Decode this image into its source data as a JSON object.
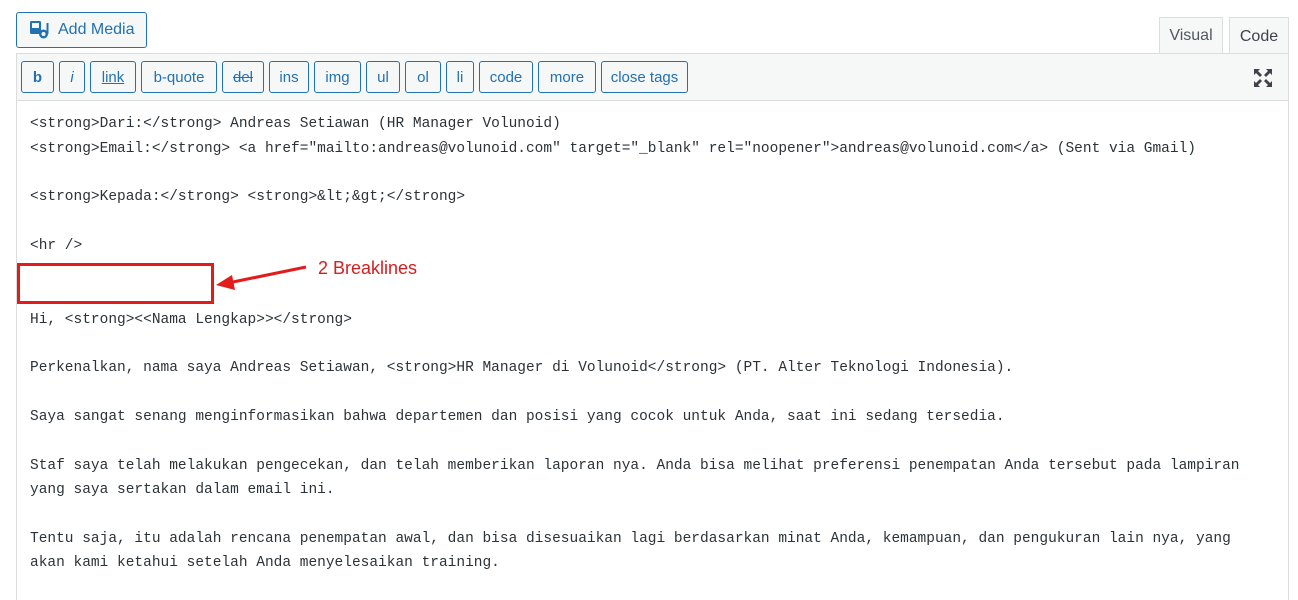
{
  "header": {
    "add_media_label": "Add Media",
    "tabs": [
      {
        "label": "Visual",
        "active": false
      },
      {
        "label": "Code",
        "active": true
      }
    ]
  },
  "toolbar": {
    "buttons": [
      "b",
      "i",
      "link",
      "b-quote",
      "del",
      "ins",
      "img",
      "ul",
      "ol",
      "li",
      "code",
      "more",
      "close tags"
    ],
    "fullscreen_icon": "fullscreen-icon"
  },
  "editor": {
    "lines": [
      "<strong>Dari:</strong> Andreas Setiawan (HR Manager Volunoid)",
      "<strong>Email:</strong> <a href=\"mailto:andreas@volunoid.com\" target=\"_blank\" rel=\"noopener\">andreas@volunoid.com</a> (Sent via Gmail)",
      "<strong>Kepada:</strong> <strong>&lt;&gt;</strong>",
      "<hr />",
      "Hi, <strong><<Nama Lengkap>></strong>",
      "Perkenalkan, nama saya Andreas Setiawan, <strong>HR Manager di Volunoid</strong> (PT. Alter Teknologi Indonesia).",
      "Saya sangat senang menginformasikan bahwa departemen dan posisi yang cocok untuk Anda, saat ini sedang tersedia.",
      "Staf saya telah melakukan pengecekan, dan telah memberikan laporan nya. Anda bisa melihat preferensi penempatan Anda tersebut pada lampiran",
      "yang saya sertakan dalam email ini.",
      "Tentu saja, itu adalah rencana penempatan awal, dan bisa disesuaikan lagi berdasarkan minat Anda, kemampuan, dan pengukuran lain nya, yang",
      "akan kami ketahui setelah Anda menyelesaikan training."
    ]
  },
  "annotation": {
    "text": "2 Breaklines",
    "color": "#d42020"
  },
  "colors": {
    "accent": "#2271b1",
    "annotation_red": "#e31b1b"
  }
}
